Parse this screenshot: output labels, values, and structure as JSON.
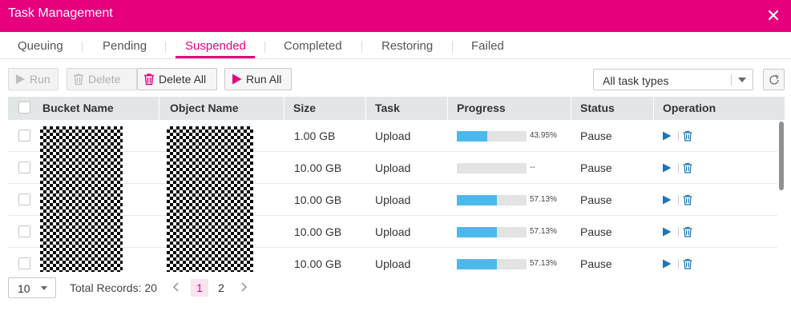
{
  "window": {
    "title": "Task Management"
  },
  "tabs": [
    {
      "label": "Queuing"
    },
    {
      "label": "Pending"
    },
    {
      "label": "Suspended",
      "active": true
    },
    {
      "label": "Completed"
    },
    {
      "label": "Restoring"
    },
    {
      "label": "Failed"
    }
  ],
  "toolbar": {
    "run_label": "Run",
    "delete_label": "Delete",
    "delete_all_label": "Delete All",
    "run_all_label": "Run All"
  },
  "filter": {
    "selected": "All task types"
  },
  "table": {
    "columns": [
      "Bucket Name",
      "Object Name",
      "Size",
      "Task",
      "Progress",
      "Status",
      "Operation"
    ],
    "rows": [
      {
        "size": "1.00 GB",
        "task": "Upload",
        "progress_value": 0.4395,
        "progress_text": "43.95%",
        "status": "Pause"
      },
      {
        "size": "10.00 GB",
        "task": "Upload",
        "progress_value": 0,
        "progress_text": "--",
        "status": "Pause"
      },
      {
        "size": "10.00 GB",
        "task": "Upload",
        "progress_value": 0.5713,
        "progress_text": "57.13%",
        "status": "Pause"
      },
      {
        "size": "10.00 GB",
        "task": "Upload",
        "progress_value": 0.5713,
        "progress_text": "57.13%",
        "status": "Pause"
      },
      {
        "size": "10.00 GB",
        "task": "Upload",
        "progress_value": 0.5713,
        "progress_text": "57.13%",
        "status": "Pause"
      }
    ]
  },
  "pagination": {
    "page_size": "10",
    "total_label": "Total Records: 20",
    "pages": [
      "1",
      "2"
    ],
    "current_page": "1"
  },
  "colors": {
    "brand": "#e6007e",
    "progress": "#4cb9ee",
    "icon": "#1b76b8",
    "header": "#e3e6e7"
  },
  "icons": [
    "close-icon",
    "play-icon",
    "trash-icon",
    "caret-down-icon",
    "refresh-icon",
    "chevron-left-icon",
    "chevron-right-icon"
  ]
}
